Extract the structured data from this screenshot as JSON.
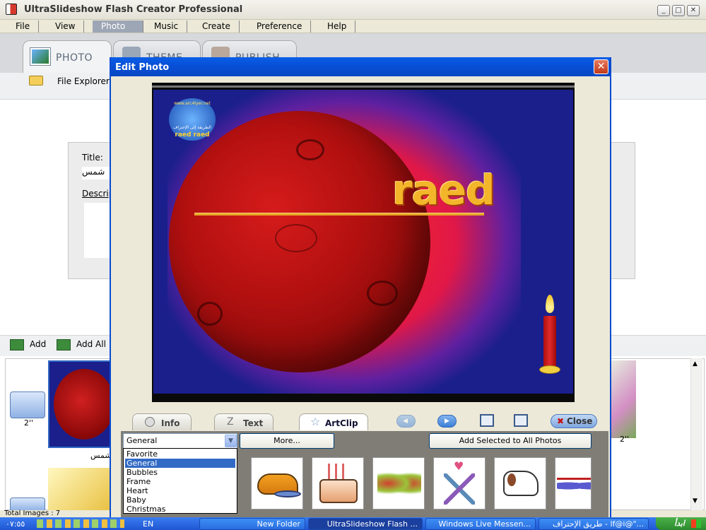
{
  "window": {
    "title": "UltraSlideshow Flash Creator Professional"
  },
  "menu": [
    "File",
    "View",
    "Photo",
    "Music",
    "Create",
    "Preference",
    "Help"
  ],
  "main_tabs": [
    {
      "label": "Photo"
    },
    {
      "label": "Theme"
    },
    {
      "label": "Publish"
    }
  ],
  "toolbar": {
    "file_explorer": "File Explorer"
  },
  "photo_info": {
    "title_label": "Title:",
    "title_value": "شمس",
    "description_label": "Description:"
  },
  "add_bar": {
    "add": "Add",
    "add_all": "Add All"
  },
  "thumbnails": {
    "duration_left": "2''",
    "duration_right": "2''",
    "caption": "شمس"
  },
  "status": {
    "total_images": "Total Images : 7"
  },
  "dialog": {
    "title": "Edit Photo",
    "overlay": {
      "logo_name": "raed raed",
      "logo_site": "www.arc4lyer.net",
      "logo_tagline": "الطريقة إلى الإحتراف",
      "text": "raed"
    },
    "tabs": [
      "Info",
      "Text",
      "ArtClip"
    ],
    "close_label": "Close",
    "category_selected": "General",
    "more_button": "More...",
    "add_all_button": "Add Selected to All Photos",
    "categories": [
      "Favorite",
      "General",
      "Bubbles",
      "Frame",
      "Heart",
      "Baby",
      "Christmas"
    ],
    "selected_category_index": 1,
    "clips": [
      "cap",
      "birthday-cake",
      "butterfly",
      "champagne-glasses",
      "dog",
      "sunglasses"
    ]
  },
  "taskbar": {
    "clock": "٠٧:٥٥",
    "language": "EN",
    "tasks": [
      "New Folder",
      "UltraSlideshow Flash ...",
      "Windows Live Messen...",
      "طريق الإحتراف - lf@i@\"..."
    ],
    "start_label": "ابدأ"
  },
  "colors": {
    "dialog_title": "#0a50d8",
    "canvas_bg": "#1a1f8c",
    "planet": "#b01414",
    "text_gold": "#f0b020",
    "selected": "#316ac5"
  }
}
